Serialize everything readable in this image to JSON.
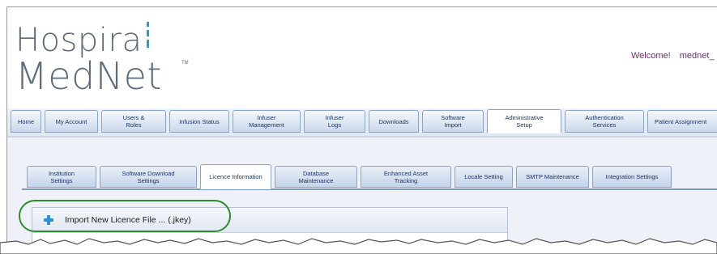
{
  "logo": {
    "line1": "Hospira",
    "line2": "MedNet",
    "tm": "TM",
    "bar_color": "#1aa3d8"
  },
  "header": {
    "welcome": "Welcome!",
    "user": "mednet_"
  },
  "main_tabs": [
    {
      "label": "Home"
    },
    {
      "label": "My Account"
    },
    {
      "label": "Users &\nRoles"
    },
    {
      "label": "Infusion Status"
    },
    {
      "label": "Infuser\nManagement"
    },
    {
      "label": "Infuser\nLogs"
    },
    {
      "label": "Downloads"
    },
    {
      "label": "Software\nImport"
    },
    {
      "label": "Administrative\nSetup",
      "active": true
    },
    {
      "label": "Authentication\nServices"
    },
    {
      "label": "Patient Assignment"
    }
  ],
  "sub_tabs": [
    {
      "label": "Institution\nSettings"
    },
    {
      "label": "Software Download\nSettings"
    },
    {
      "label": "Licence Information",
      "active": true
    },
    {
      "label": "Database\nMaintenance"
    },
    {
      "label": "Enhanced Asset\nTracking"
    },
    {
      "label": "Locale Setting"
    },
    {
      "label": "SMTP Maintenance"
    },
    {
      "label": "Integration Settings"
    }
  ],
  "toolbar": {
    "import_label": "Import New Licence File ... (.jkey)",
    "icon": "plus-icon"
  },
  "colors": {
    "accent": "#1d3460",
    "highlight": "#2e8b2e",
    "welcome": "#6a3070"
  }
}
